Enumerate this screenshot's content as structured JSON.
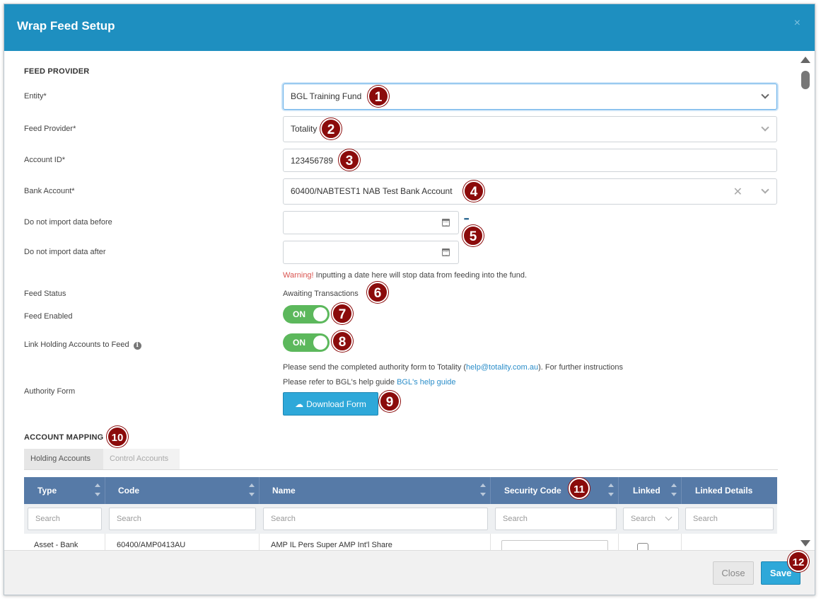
{
  "header": {
    "title": "Wrap Feed Setup",
    "close_glyph": "×"
  },
  "feed_provider": {
    "section_title": "FEED PROVIDER",
    "entity": {
      "label": "Entity*",
      "value": "BGL Training Fund"
    },
    "feed_provider": {
      "label": "Feed Provider*",
      "value": "Totality"
    },
    "account_id": {
      "label": "Account ID*",
      "value": "123456789"
    },
    "bank_account": {
      "label": "Bank Account*",
      "value": "60400/NABTEST1 NAB Test Bank Account"
    },
    "date_before": {
      "label": "Do not import data before",
      "value": ""
    },
    "date_after": {
      "label": "Do not import data after",
      "value": ""
    },
    "more_glyph": "•••",
    "warning": {
      "prefix": "Warning!",
      "text": " Inputting a date here will stop data from feeding into the fund."
    },
    "feed_status": {
      "label": "Feed Status",
      "value": "Awaiting Transactions"
    },
    "feed_enabled": {
      "label": "Feed Enabled",
      "state": "ON"
    },
    "link_holding": {
      "label": "Link Holding Accounts to Feed",
      "state": "ON",
      "info_icon": "info-icon"
    },
    "authority": {
      "label": "Authority Form",
      "line1_pre": "Please send the completed authority form to Totality (",
      "line1_link": "help@totality.com.au",
      "line1_post": "). For further instructions",
      "line2_pre": "Please refer to BGL's help guide ",
      "line2_link": "BGL's help guide",
      "download_label": "Download Form",
      "download_icon": "cloud-download-icon"
    }
  },
  "account_mapping": {
    "section_title": "ACCOUNT MAPPING",
    "tabs": [
      {
        "label": "Holding Accounts",
        "active": true
      },
      {
        "label": "Control Accounts",
        "active": false
      }
    ],
    "columns": [
      "Type",
      "Code",
      "Name",
      "Security Code",
      "Linked",
      "Linked Details"
    ],
    "search_placeholder": "Search",
    "rows": [
      {
        "type": "Asset - Bank",
        "code": "60400/AMP0413AU",
        "name": "AMP IL Pers Super AMP Int'l Share",
        "security_code": "",
        "linked": false,
        "linked_details": ""
      }
    ]
  },
  "annotations": [
    "1",
    "2",
    "3",
    "4",
    "5",
    "6",
    "7",
    "8",
    "9",
    "10",
    "11",
    "12"
  ],
  "footer": {
    "close_label": "Close",
    "save_label": "Save"
  },
  "colors": {
    "header": "#1e8fc0",
    "table_header": "#567aa7",
    "toggle_on": "#5cb85c",
    "primary_button": "#2ea8d9",
    "badge": "#8b0b0b",
    "warning": "#d9534f"
  }
}
